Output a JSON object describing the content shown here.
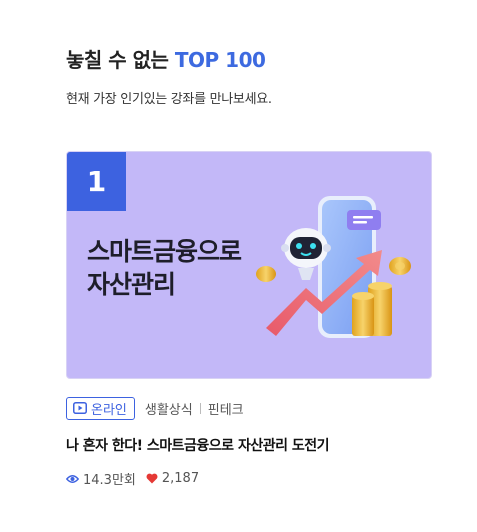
{
  "section": {
    "title_prefix": "놓칠 수 없는",
    "title_accent": "TOP 100",
    "subtitle": "현재 가장 인기있는 강좌를 만나보세요."
  },
  "card": {
    "rank": "1",
    "headline_line1": "스마트금융으로",
    "headline_line2": "자산관리",
    "background_color": "#c3b8f8",
    "rank_color": "#3d62e0"
  },
  "meta": {
    "badge_label": "온라인",
    "badge_icon": "play-icon",
    "category_1": "생활상식",
    "category_2": "핀테크"
  },
  "course": {
    "title": "나 혼자 한다! 스마트금융으로 자산관리 도전기"
  },
  "stats": {
    "views": "14.3만회",
    "views_icon": "eye-icon",
    "likes": "2,187",
    "likes_icon": "heart-icon"
  }
}
